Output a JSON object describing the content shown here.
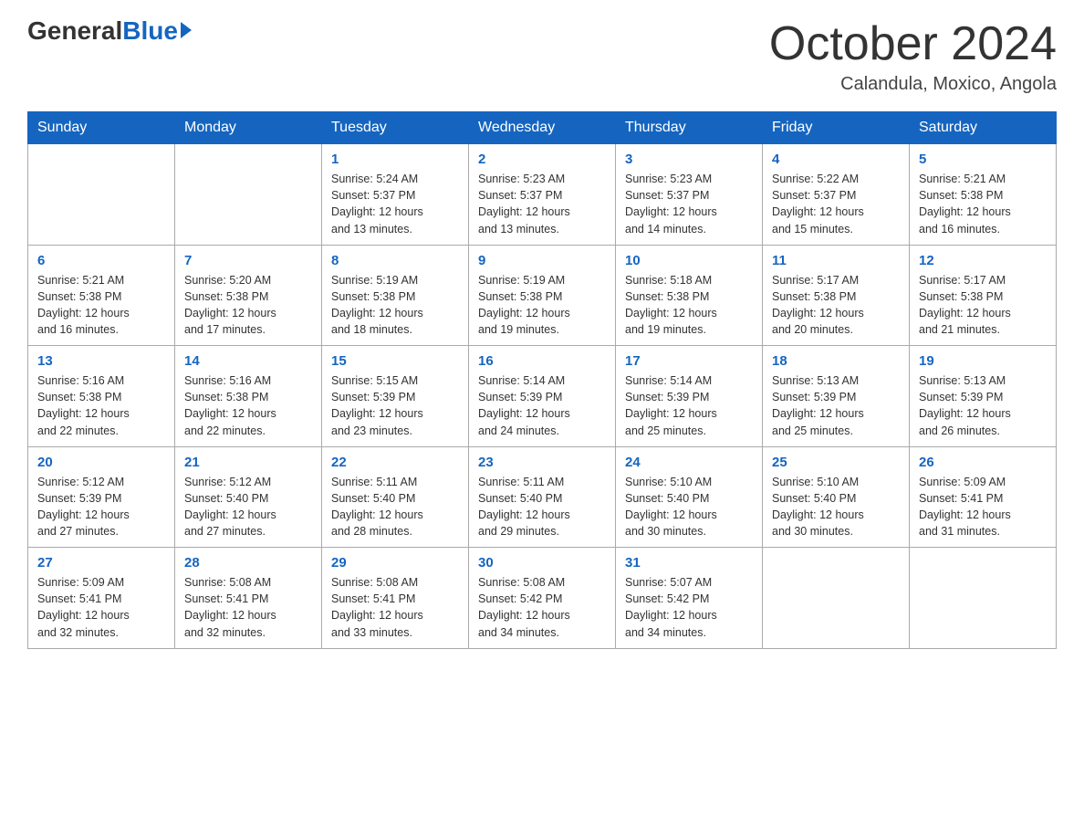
{
  "header": {
    "logo_general": "General",
    "logo_blue": "Blue",
    "main_title": "October 2024",
    "subtitle": "Calandula, Moxico, Angola"
  },
  "calendar": {
    "days_of_week": [
      "Sunday",
      "Monday",
      "Tuesday",
      "Wednesday",
      "Thursday",
      "Friday",
      "Saturday"
    ],
    "weeks": [
      [
        {
          "day": "",
          "info": ""
        },
        {
          "day": "",
          "info": ""
        },
        {
          "day": "1",
          "info": "Sunrise: 5:24 AM\nSunset: 5:37 PM\nDaylight: 12 hours\nand 13 minutes."
        },
        {
          "day": "2",
          "info": "Sunrise: 5:23 AM\nSunset: 5:37 PM\nDaylight: 12 hours\nand 13 minutes."
        },
        {
          "day": "3",
          "info": "Sunrise: 5:23 AM\nSunset: 5:37 PM\nDaylight: 12 hours\nand 14 minutes."
        },
        {
          "day": "4",
          "info": "Sunrise: 5:22 AM\nSunset: 5:37 PM\nDaylight: 12 hours\nand 15 minutes."
        },
        {
          "day": "5",
          "info": "Sunrise: 5:21 AM\nSunset: 5:38 PM\nDaylight: 12 hours\nand 16 minutes."
        }
      ],
      [
        {
          "day": "6",
          "info": "Sunrise: 5:21 AM\nSunset: 5:38 PM\nDaylight: 12 hours\nand 16 minutes."
        },
        {
          "day": "7",
          "info": "Sunrise: 5:20 AM\nSunset: 5:38 PM\nDaylight: 12 hours\nand 17 minutes."
        },
        {
          "day": "8",
          "info": "Sunrise: 5:19 AM\nSunset: 5:38 PM\nDaylight: 12 hours\nand 18 minutes."
        },
        {
          "day": "9",
          "info": "Sunrise: 5:19 AM\nSunset: 5:38 PM\nDaylight: 12 hours\nand 19 minutes."
        },
        {
          "day": "10",
          "info": "Sunrise: 5:18 AM\nSunset: 5:38 PM\nDaylight: 12 hours\nand 19 minutes."
        },
        {
          "day": "11",
          "info": "Sunrise: 5:17 AM\nSunset: 5:38 PM\nDaylight: 12 hours\nand 20 minutes."
        },
        {
          "day": "12",
          "info": "Sunrise: 5:17 AM\nSunset: 5:38 PM\nDaylight: 12 hours\nand 21 minutes."
        }
      ],
      [
        {
          "day": "13",
          "info": "Sunrise: 5:16 AM\nSunset: 5:38 PM\nDaylight: 12 hours\nand 22 minutes."
        },
        {
          "day": "14",
          "info": "Sunrise: 5:16 AM\nSunset: 5:38 PM\nDaylight: 12 hours\nand 22 minutes."
        },
        {
          "day": "15",
          "info": "Sunrise: 5:15 AM\nSunset: 5:39 PM\nDaylight: 12 hours\nand 23 minutes."
        },
        {
          "day": "16",
          "info": "Sunrise: 5:14 AM\nSunset: 5:39 PM\nDaylight: 12 hours\nand 24 minutes."
        },
        {
          "day": "17",
          "info": "Sunrise: 5:14 AM\nSunset: 5:39 PM\nDaylight: 12 hours\nand 25 minutes."
        },
        {
          "day": "18",
          "info": "Sunrise: 5:13 AM\nSunset: 5:39 PM\nDaylight: 12 hours\nand 25 minutes."
        },
        {
          "day": "19",
          "info": "Sunrise: 5:13 AM\nSunset: 5:39 PM\nDaylight: 12 hours\nand 26 minutes."
        }
      ],
      [
        {
          "day": "20",
          "info": "Sunrise: 5:12 AM\nSunset: 5:39 PM\nDaylight: 12 hours\nand 27 minutes."
        },
        {
          "day": "21",
          "info": "Sunrise: 5:12 AM\nSunset: 5:40 PM\nDaylight: 12 hours\nand 27 minutes."
        },
        {
          "day": "22",
          "info": "Sunrise: 5:11 AM\nSunset: 5:40 PM\nDaylight: 12 hours\nand 28 minutes."
        },
        {
          "day": "23",
          "info": "Sunrise: 5:11 AM\nSunset: 5:40 PM\nDaylight: 12 hours\nand 29 minutes."
        },
        {
          "day": "24",
          "info": "Sunrise: 5:10 AM\nSunset: 5:40 PM\nDaylight: 12 hours\nand 30 minutes."
        },
        {
          "day": "25",
          "info": "Sunrise: 5:10 AM\nSunset: 5:40 PM\nDaylight: 12 hours\nand 30 minutes."
        },
        {
          "day": "26",
          "info": "Sunrise: 5:09 AM\nSunset: 5:41 PM\nDaylight: 12 hours\nand 31 minutes."
        }
      ],
      [
        {
          "day": "27",
          "info": "Sunrise: 5:09 AM\nSunset: 5:41 PM\nDaylight: 12 hours\nand 32 minutes."
        },
        {
          "day": "28",
          "info": "Sunrise: 5:08 AM\nSunset: 5:41 PM\nDaylight: 12 hours\nand 32 minutes."
        },
        {
          "day": "29",
          "info": "Sunrise: 5:08 AM\nSunset: 5:41 PM\nDaylight: 12 hours\nand 33 minutes."
        },
        {
          "day": "30",
          "info": "Sunrise: 5:08 AM\nSunset: 5:42 PM\nDaylight: 12 hours\nand 34 minutes."
        },
        {
          "day": "31",
          "info": "Sunrise: 5:07 AM\nSunset: 5:42 PM\nDaylight: 12 hours\nand 34 minutes."
        },
        {
          "day": "",
          "info": ""
        },
        {
          "day": "",
          "info": ""
        }
      ]
    ]
  }
}
